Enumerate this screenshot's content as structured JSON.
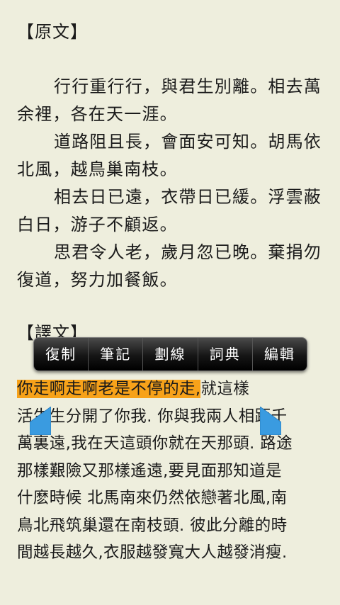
{
  "original": {
    "heading": "【原文】",
    "paragraphs": [
      "行行重行行，與君生別離。相去萬余裡，各在天一涯。",
      "道路阻且長，會面安可知。胡馬依北風，越鳥巢南枝。",
      "相去日已遠，衣帶日已緩。浮雲蔽白日，游子不顧返。",
      "思君令人老，歲月忽已晚。棄捐勿復道，努力加餐飯。"
    ]
  },
  "translation": {
    "heading": "【譯文】",
    "lines": [
      {
        "highlight": "你走啊走啊老是不停的走,",
        "rest": "就這樣"
      },
      {
        "highlight": "",
        "rest": "活生生分開了你我. 你與我兩人相距千"
      },
      {
        "highlight": "",
        "rest": "萬裏遠,我在天這頭你就在天那頭. 路途"
      },
      {
        "highlight": "",
        "rest": "那樣艱險又那樣遙遠,要見面那知道是"
      },
      {
        "highlight": "",
        "rest": "什麽時候 北馬南來仍然依戀著北風,南"
      },
      {
        "highlight": "",
        "rest": "鳥北飛筑巢還在南枝頭. 彼此分離的時"
      },
      {
        "highlight": "",
        "rest": "間越長越久,衣服越發寬大人越發消瘦."
      }
    ]
  },
  "selection_menu": {
    "items": [
      "復制",
      "筆記",
      "劃線",
      "詞典",
      "編輯"
    ]
  },
  "colors": {
    "background": "#eeeedd",
    "highlight": "#f7a21a",
    "handle": "#3a9be0"
  }
}
